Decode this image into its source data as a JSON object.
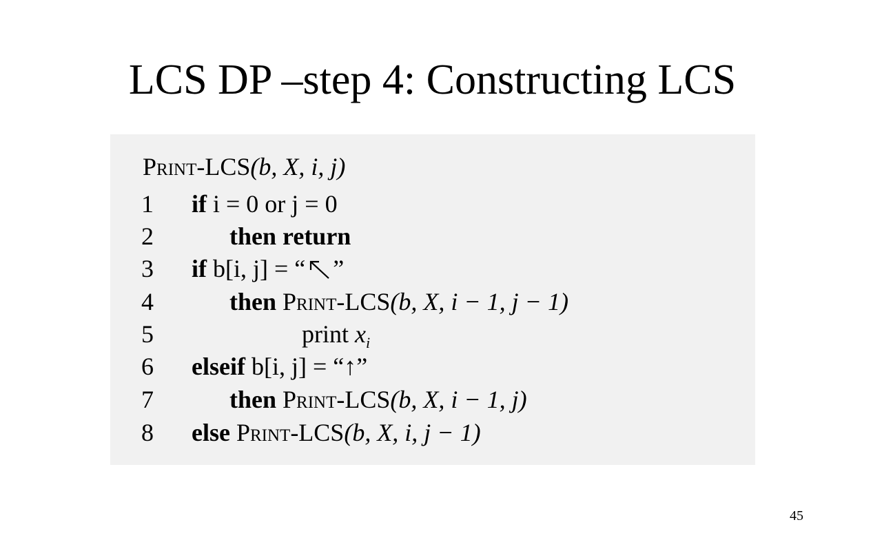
{
  "slide": {
    "title": "LCS DP –step 4: Constructing LCS",
    "page_number": "45"
  },
  "algorithm": {
    "header": {
      "name": "Print-LCS",
      "params": "(b, X, i, j)"
    },
    "lines": [
      {
        "num": "1",
        "kw1": "if",
        "t1": " i = 0 or j = 0"
      },
      {
        "num": "2",
        "kw1": "then return"
      },
      {
        "num": "3",
        "kw1": "if",
        "t1": " b[i, j] = “",
        "arrow": "up-left-arrow",
        "t2": "”"
      },
      {
        "num": "4",
        "kw1": "then",
        "t1": " ",
        "proc": "Print-LCS",
        "t2": "(b, X, i − 1, j − 1)"
      },
      {
        "num": "5",
        "t1": "print ",
        "var": "x",
        "sub": "i"
      },
      {
        "num": "6",
        "kw1": "elseif",
        "t1": " b[i, j] = “↑”"
      },
      {
        "num": "7",
        "kw1": "then",
        "t1": " ",
        "proc": "Print-LCS",
        "t2": "(b, X, i − 1, j)"
      },
      {
        "num": "8",
        "kw1": "else",
        "t1": " ",
        "proc": "Print-LCS",
        "t2": "(b, X, i, j − 1)"
      }
    ]
  },
  "colors": {
    "panel_background": "#f1f1f1",
    "text": "#000000"
  }
}
